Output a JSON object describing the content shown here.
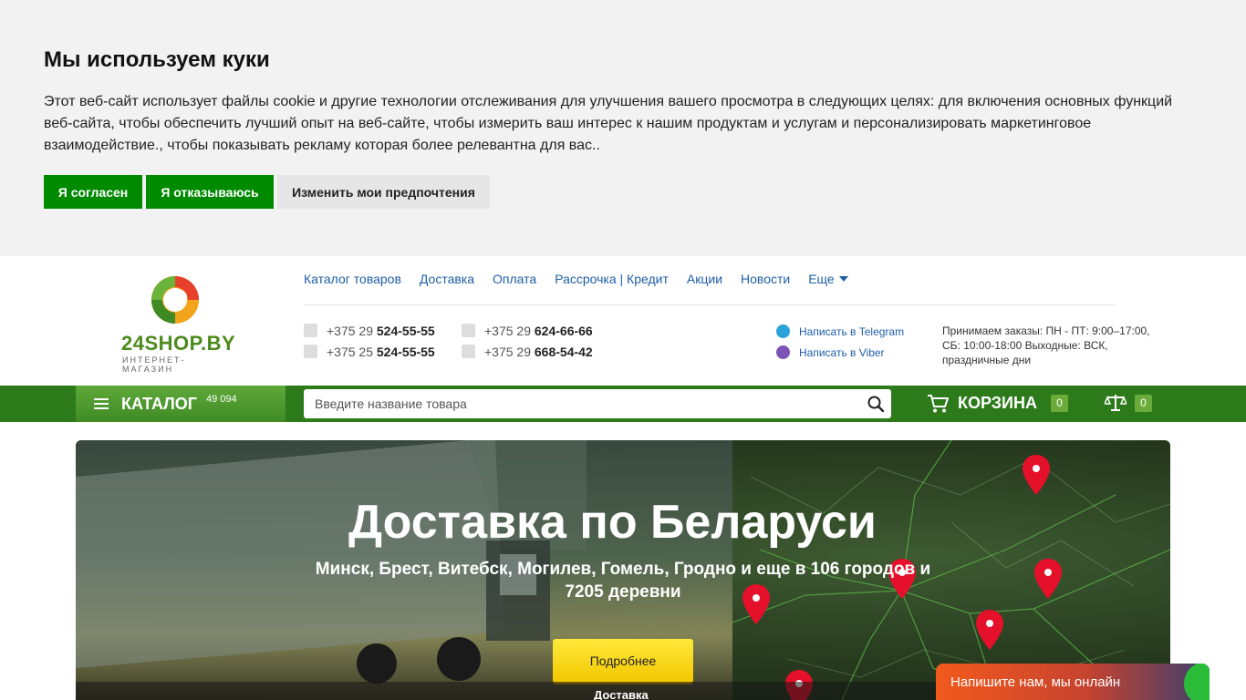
{
  "cookie_banner": {
    "title": "Мы используем куки",
    "text": "Этот веб-сайт использует файлы cookie и другие технологии отслеживания для улучшения вашего просмотра в следующих целях: для включения основных функций веб-сайта, чтобы обеспечить лучший опыт на веб-сайте, чтобы измерить ваш интерес к нашим продуктам и услугам и персонализировать маркетинговое взаимодействие., чтобы показывать рекламу которая более релевантна для вас..",
    "accept_label": "Я согласен",
    "decline_label": "Я отказываюсь",
    "preferences_label": "Изменить мои предпочтения",
    "accent_color": "#008a00"
  },
  "logo": {
    "name": "24SHOP.BY",
    "subtitle": "ИНТЕРНЕТ-МАГАЗИН"
  },
  "nav": {
    "items": [
      "Каталог товаров",
      "Доставка",
      "Оплата",
      "Рассрочка | Кредит",
      "Акции",
      "Новости"
    ],
    "more_label": "Еще"
  },
  "phones": [
    {
      "prefix": "+375 29",
      "number": "524-55-55",
      "operator_icon": "a1-icon"
    },
    {
      "prefix": "+375 25",
      "number": "524-55-55",
      "operator_icon": "life-icon"
    },
    {
      "prefix": "+375 29",
      "number": "624-66-66",
      "operator_icon": "mts-icon"
    },
    {
      "prefix": "+375 29",
      "number": "668-54-42",
      "operator_icon": "mts-icon"
    }
  ],
  "messengers": {
    "telegram_label": "Написать в Telegram",
    "viber_label": "Написать в Viber"
  },
  "hours": "Принимаем заказы: ПН - ПТ: 9:00–17:00, СБ: 10:00-18:00 Выходные: ВСК, праздничные дни",
  "toolbar": {
    "catalog_label": "КАТАЛОГ",
    "catalog_count": "49 094",
    "search_placeholder": "Введите название товара",
    "cart_label": "КОРЗИНА",
    "cart_count": "0",
    "compare_count": "0",
    "bar_color": "#2c7a1a"
  },
  "banner": {
    "title": "Доставка по Беларуси",
    "subtitle": "Минск, Брест, Витебск, Могилев, Гомель, Гродно и еще в 106 городов и 7205 деревни",
    "button_label": "Подробнее",
    "tab_label": "Доставка"
  },
  "chat": {
    "label": "Напишите нам, мы онлайн"
  }
}
